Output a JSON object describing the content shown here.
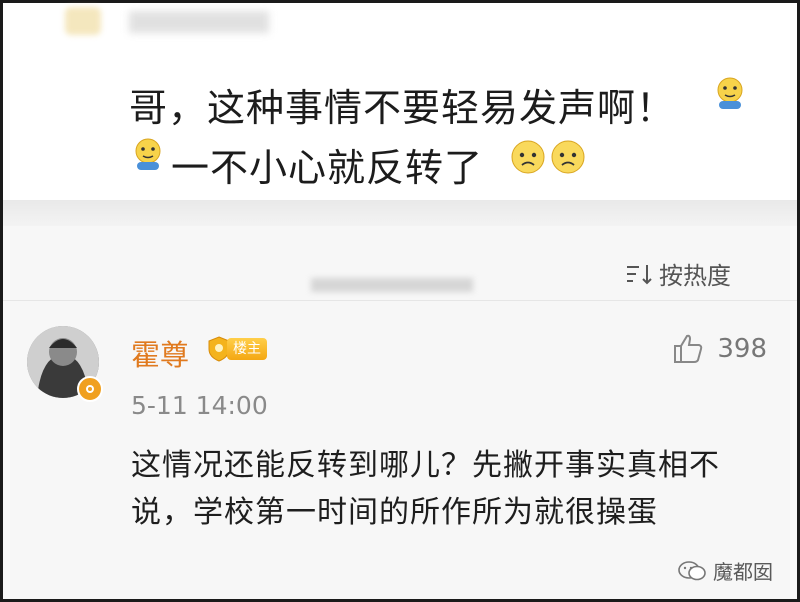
{
  "post": {
    "line1": "哥，这种事情不要轻易发声啊！",
    "line2": "一不小心就反转了",
    "emojis": [
      "thinking-face-icon",
      "thinking-face-icon",
      "sad-face-icon",
      "sad-face-icon"
    ]
  },
  "sort": {
    "label": "按热度"
  },
  "comment": {
    "username": "霍尊",
    "fan_badge": "楼主",
    "likes": "398",
    "time": "5-11 14:00",
    "text": "这情况还能反转到哪儿？先撇开事实真相不说，学校第一时间的所作所为就很操蛋"
  },
  "watermark": {
    "text": "魔都囡"
  },
  "colors": {
    "username": "#e07a1f",
    "badge": "#f4a712",
    "text": "#1e1e1e",
    "meta": "#8a8a8a"
  }
}
